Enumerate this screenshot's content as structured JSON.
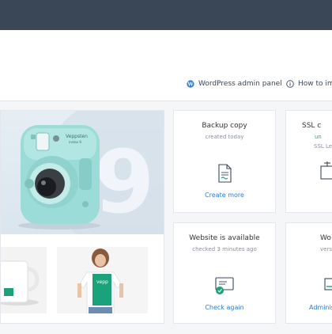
{
  "topbar": {},
  "links": {
    "wordpress": "WordPress admin panel",
    "howto": "How to im"
  },
  "cards": {
    "backup": {
      "title": "Backup copy",
      "subtitle": "created today",
      "action": "Create more"
    },
    "ssl": {
      "title": "SSL c",
      "status": "un",
      "detail": "SSL Le"
    },
    "website": {
      "title": "Website is available",
      "subtitle": "checked 3 minutes ago",
      "action": "Check again"
    },
    "wordpress": {
      "title": "Wo",
      "subtitle": "versi",
      "action": "Adminis"
    }
  },
  "preview": {
    "camera_brand": "Veppsten",
    "camera_model": "instax 9",
    "shirt_text": "vepp"
  },
  "colors": {
    "topbar": "#3a4757",
    "link": "#2a7bd6",
    "success": "#2fb344",
    "accent_green": "#1aa37a",
    "camera": "#9cdcd8"
  }
}
